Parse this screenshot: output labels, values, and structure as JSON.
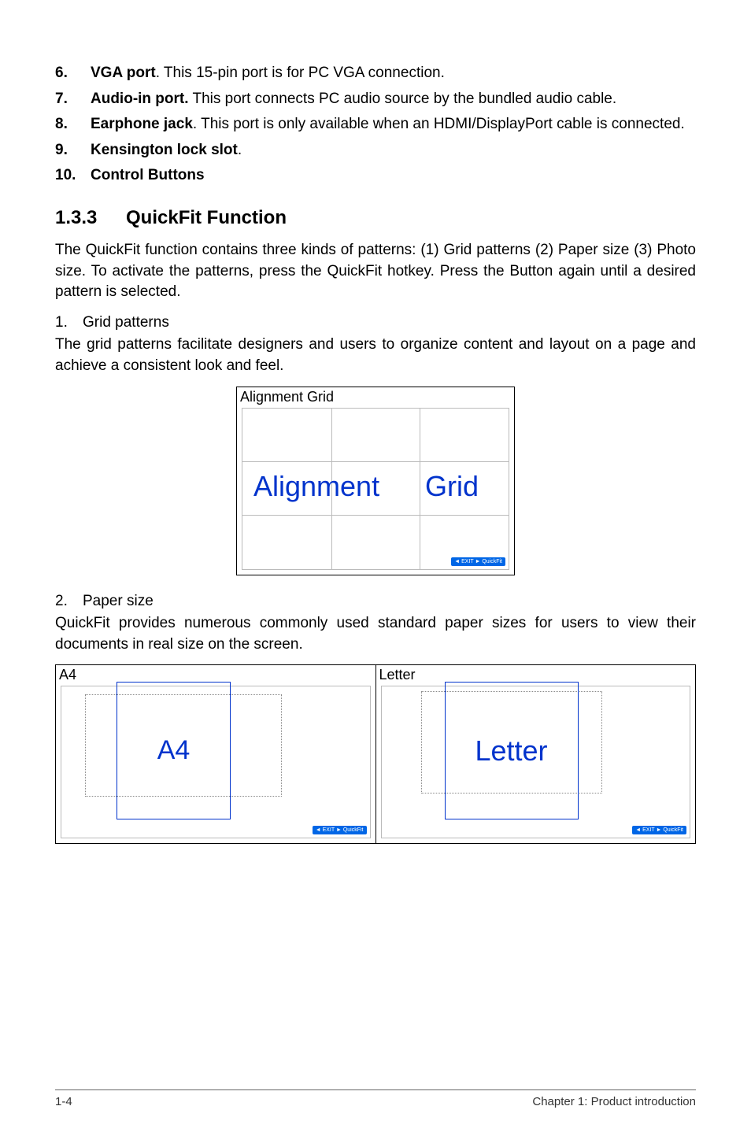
{
  "list": [
    {
      "num": "6.",
      "title": "VGA port",
      "sep": ". ",
      "desc": "This 15-pin port is for PC VGA connection."
    },
    {
      "num": "7.",
      "title": "Audio-in port.",
      "sep": " ",
      "desc": "This port connects PC audio source by the bundled audio cable."
    },
    {
      "num": "8.",
      "title": "Earphone jack",
      "sep": ". ",
      "desc": "This port is only available when an HDMI/DisplayPort cable is connected."
    },
    {
      "num": "9.",
      "title": "Kensington lock slot",
      "sep": ".",
      "desc": ""
    },
    {
      "num": "10.",
      "title": "Control Buttons",
      "sep": "",
      "desc": ""
    }
  ],
  "section": {
    "num": "1.3.3",
    "title": "QuickFit Function"
  },
  "intro": "The QuickFit function contains three kinds of patterns: (1) Grid patterns (2) Paper size (3) Photo size. To activate the patterns, press the QuickFit hotkey. Press the Button again until a desired pattern is selected.",
  "grid": {
    "num": "1.",
    "title": "Grid patterns",
    "desc": "The grid patterns facilitate designers and users to organize content and layout on a page and achieve a consistent look and feel.",
    "figlabel": "Alignment Grid",
    "figtext1": "Alignment",
    "figtext2": "Grid",
    "hint": "◄ EXIT ► QuickFit"
  },
  "paper": {
    "num": "2.",
    "title": "Paper size",
    "desc": "QuickFit provides numerous commonly used standard paper sizes for users to view their documents in real size on the screen.",
    "a4label": "A4",
    "a4text": "A4",
    "letterlabel": "Letter",
    "lettertext": "Letter",
    "hint": "◄ EXIT ► QuickFit"
  },
  "footer": {
    "left": "1-4",
    "right": "Chapter 1: Product introduction"
  }
}
